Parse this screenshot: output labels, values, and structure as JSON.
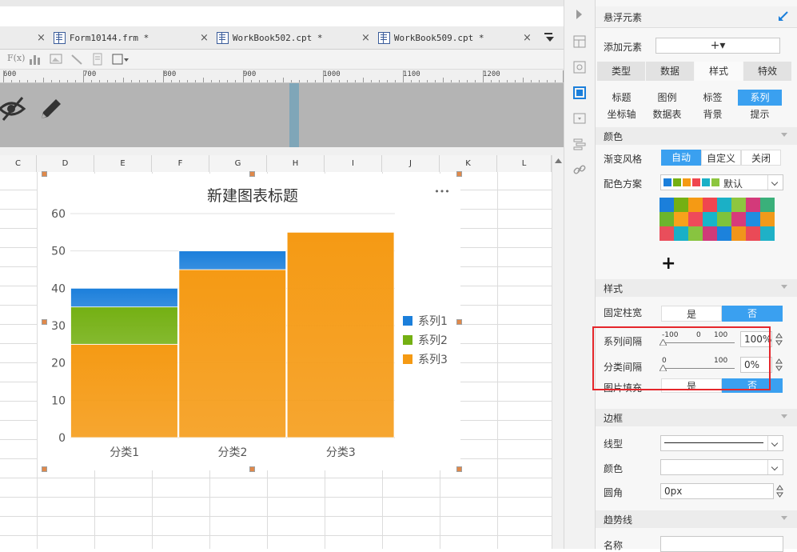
{
  "tabs": [
    {
      "label": "Form10144.frm *"
    },
    {
      "label": "WorkBook502.cpt *"
    },
    {
      "label": "WorkBook509.cpt *"
    }
  ],
  "toolbar": {
    "fx_label": "F(x)"
  },
  "ruler": {
    "labels": [
      "600",
      "700",
      "800",
      "900",
      "1000",
      "1100",
      "1200"
    ]
  },
  "sheet": {
    "columns": [
      "C",
      "D",
      "E",
      "F",
      "G",
      "H",
      "I",
      "J",
      "K",
      "L"
    ]
  },
  "chart_data": {
    "type": "bar",
    "stacked": true,
    "title": "新建图表标题",
    "categories": [
      "分类1",
      "分类2",
      "分类3"
    ],
    "series": [
      {
        "name": "系列1",
        "values": [
          5,
          5,
          0
        ],
        "color": "#1b7fdb"
      },
      {
        "name": "系列2",
        "values": [
          10,
          0,
          0
        ],
        "color": "#74b013"
      },
      {
        "name": "系列3",
        "values": [
          25,
          45,
          55
        ],
        "color": "#f59a14"
      }
    ],
    "ylim": [
      0,
      60
    ],
    "yticks": [
      0,
      10,
      20,
      30,
      40,
      50,
      60
    ],
    "grid": true,
    "legend": "right",
    "more_icon": "•••"
  },
  "panel": {
    "title": "悬浮元素",
    "add_label": "添加元素",
    "add_value": "+▾",
    "main_tabs": [
      "类型",
      "数据",
      "样式",
      "特效"
    ],
    "main_active": 2,
    "sub_tabs": [
      "标题",
      "图例",
      "标签",
      "系列",
      "坐标轴",
      "数据表",
      "背景",
      "提示"
    ],
    "sub_active": 3,
    "color_section": "颜色",
    "gradient_label": "渐变风格",
    "gradient_options": [
      "自动",
      "自定义",
      "关闭"
    ],
    "gradient_active": 0,
    "scheme_label": "配色方案",
    "scheme_value": "默认",
    "palette": [
      "#1b7fdb",
      "#74b013",
      "#f59a14",
      "#f0464f",
      "#1bb0c6",
      "#8dc63f",
      "#d33a7a",
      "#3ab07a",
      "#6cb52d",
      "#f7a21b",
      "#ef4a5a",
      "#18b5c9",
      "#7ec33c",
      "#d73b7b",
      "#1f8ee0",
      "#f19a1a",
      "#e94e5b",
      "#19b0c7",
      "#88c440",
      "#d03a79",
      "#1c82dc",
      "#f0951b",
      "#ea4a57",
      "#1fb1c7"
    ],
    "add_color": "+",
    "style_section": "样式",
    "fixed_width_label": "固定柱宽",
    "fixed_width_options": [
      "是",
      "否"
    ],
    "fixed_width_active": 1,
    "series_gap_label": "系列间隔",
    "series_gap_scale": [
      "-100",
      "0",
      "100"
    ],
    "series_gap_value": "100%",
    "cat_gap_label": "分类间隔",
    "cat_gap_scale": [
      "0",
      "100"
    ],
    "cat_gap_value": "0%",
    "img_fill_label": "图片填充",
    "img_fill_options": [
      "是",
      "否"
    ],
    "img_fill_active": 1,
    "border_section": "边框",
    "line_type_label": "线型",
    "border_color_label": "颜色",
    "radius_label": "圆角",
    "radius_value": "0px",
    "trend_section": "趋势线",
    "name_label": "名称"
  },
  "colors": {
    "accent": "#3aa0f0",
    "highlight_box": "#e5262b"
  }
}
